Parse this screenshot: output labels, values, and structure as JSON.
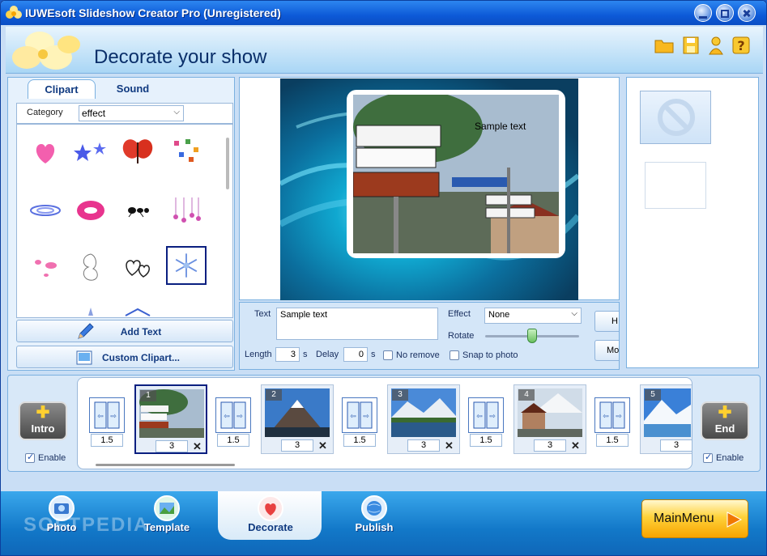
{
  "window": {
    "title": "IUWEsoft Slideshow Creator Pro (Unregistered)"
  },
  "header": {
    "title": "Decorate your show",
    "icons": [
      "folder-icon",
      "save-icon",
      "help-person-icon",
      "question-icon"
    ]
  },
  "tabs": [
    {
      "label": "Clipart"
    },
    {
      "label": "Sound"
    }
  ],
  "category": {
    "label": "Category",
    "value": "effect"
  },
  "buttons": {
    "add_text": "Add Text",
    "custom_clipart": "Custom Clipart...",
    "h_short": "H",
    "mo_short": "Mo"
  },
  "preview": {
    "sample_text": "Sample text"
  },
  "text_panel": {
    "text_label": "Text",
    "text_value": "Sample text",
    "effect_label": "Effect",
    "effect_value": "None",
    "rotate_label": "Rotate",
    "length_label": "Length",
    "length_value": "3",
    "length_unit": "s",
    "delay_label": "Delay",
    "delay_value": "0",
    "delay_unit": "s",
    "no_remove": "No remove",
    "snap_to_photo": "Snap to photo",
    "rotate_fraction": 0.5
  },
  "timeline": {
    "intro_label": "Intro",
    "end_label": "End",
    "enable_label": "Enable",
    "slides": [
      {
        "num": "1",
        "duration": "3"
      },
      {
        "num": "2",
        "duration": "3"
      },
      {
        "num": "3",
        "duration": "3"
      },
      {
        "num": "4",
        "duration": "3"
      },
      {
        "num": "5",
        "duration": "3"
      }
    ],
    "transitions": [
      "1.5",
      "1.5",
      "1.5",
      "1.5",
      "1.5"
    ]
  },
  "nav": {
    "photo": "Photo",
    "template": "Template",
    "decorate": "Decorate",
    "publish": "Publish",
    "main_menu": "MainMenu"
  },
  "watermark": "SOFTPEDIA",
  "colors": {
    "titlebar": "#0d5ad8",
    "accent": "#1278c8",
    "selection": "#0a1f80",
    "mainmenu": "#ffd23a"
  }
}
